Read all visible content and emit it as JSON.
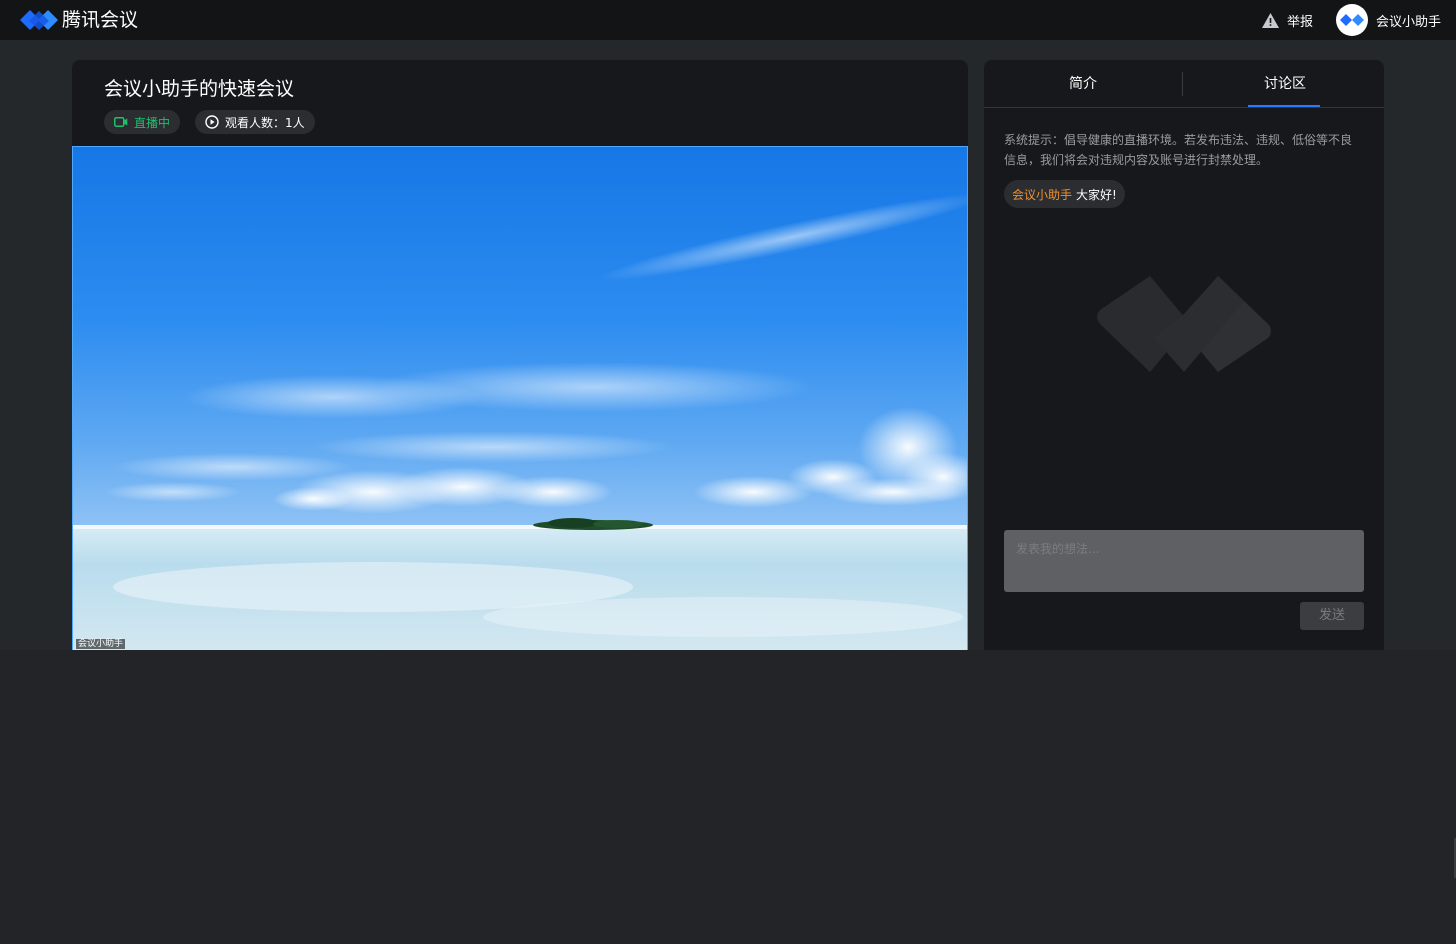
{
  "header": {
    "app_name": "腾讯会议",
    "report_label": "举报",
    "user_name": "会议小助手",
    "brand_color": "#1e6bff"
  },
  "meeting": {
    "title": "会议小助手的快速会议",
    "live_label": "直播中",
    "viewers_label": "观看人数：1人",
    "speaker_tag": "会议小助手",
    "live_color": "#1fbf6b"
  },
  "sidebar": {
    "tabs": [
      {
        "label": "简介"
      },
      {
        "label": "讨论区",
        "active": true
      }
    ],
    "system_tip": "系统提示：倡导健康的直播环境。若发布违法、违规、低俗等不良信息，我们将会对违规内容及账号进行封禁处理。",
    "messages": [
      {
        "sender": "会议小助手",
        "text": "大家好!"
      }
    ],
    "input_placeholder": "发表我的想法...",
    "send_label": "发送",
    "accent_color": "#2a79ff",
    "sender_color": "#f0912f"
  },
  "icons": [
    "tencent-meeting-logo-icon",
    "warning-icon",
    "camera-icon",
    "play-icon",
    "watermark-logo-icon"
  ]
}
